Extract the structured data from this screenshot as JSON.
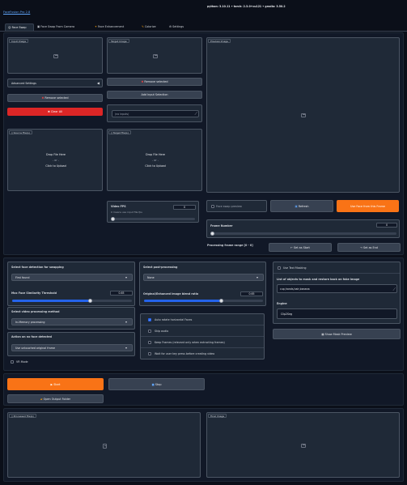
{
  "header": {
    "app_link": "FaceFusion Pro 2.8",
    "version_info": "python: 3.10.11  •  torch: 2.3.0+cu121  •  gradio: 3.50.2"
  },
  "tabs": [
    {
      "label": "Face Swap",
      "icon": "face-icon",
      "active": true
    },
    {
      "label": "Face Swap From Camera",
      "icon": "camera-icon",
      "active": false
    },
    {
      "label": "Face Enhancement",
      "icon": "sparkle-icon",
      "active": false
    },
    {
      "label": "Colorize",
      "icon": "brush-icon",
      "active": false
    },
    {
      "label": "Settings",
      "icon": "gear-icon",
      "active": false
    }
  ],
  "left": {
    "input_image_label": "Input Image",
    "advanced_settings_label": "Advanced Settings",
    "remove_selected_label": "Remove selected",
    "clear_all_label": "Clear All",
    "source_file_label": "Source File(s)",
    "drop_here": "Drop File Here",
    "or": "- or -",
    "click_upload": "Click to Upload"
  },
  "middle": {
    "face_image_label": "Target Image",
    "remove_selected_label": "Remove selected",
    "add_label": "Add Input Selection",
    "textbox_placeholder": "(no inputs)",
    "target_file_label": "Target File(s)",
    "drop_here": "Drop File Here",
    "or": "- or -",
    "click_upload": "Click to Upload",
    "fps_label": "Video FPS",
    "fps_hint": "0 means use input file fps",
    "fps_value": "0",
    "fps_level": 0.0
  },
  "right": {
    "preview_label": "Preview Image",
    "face_preview_label": "Face swap preview",
    "refresh_label": "Refresh",
    "use_face_label": "Use Face from this Frame",
    "frame_number_label": "Frame Number",
    "frame_number_value": "0",
    "frame_level": 0.0,
    "processing_range_label": "Processing frame range [0 - 0]",
    "set_start_label": "← Set as Start",
    "set_end_label": "→ Set as End"
  },
  "settings": {
    "face_detection_label": "Select face detection for swapping",
    "face_detection_value": "First found",
    "similarity_label": "Max Face Similarity Threshold",
    "similarity_value": "0.65",
    "similarity_level": 0.65,
    "video_processing_label": "Select video processing method",
    "video_processing_value": "In-Memory processing",
    "no_face_label": "Action on no face detected",
    "no_face_value": "Use untouched original frame",
    "vr_mode_label": "VR Mode",
    "post_processing_label": "Select post-processing",
    "post_processing_value": "None",
    "blend_label": "Original/Enhanced image blend ratio",
    "blend_value": "0.65",
    "blend_level": 0.65,
    "auto_rotate_label": "Auto rotate horizontal Faces",
    "skip_audio_label": "Skip audio",
    "keep_frames_label": "Keep Frames (relevant only when extracting frames)",
    "wait_user_label": "Wait for user key press before creating video",
    "text_masking_label": "Use Text Masking",
    "text_masking_list_label": "List of objects to mask and restore back on fake image",
    "text_masking_value": "cup,hands,hair,banana",
    "engine_label": "Engine",
    "engine_value": "Clip2Seg",
    "show_mask_label": "Show Mask Preview"
  },
  "actions": {
    "start_label": "Start",
    "stop_label": "Stop",
    "open_folder_label": "Open Output Folder"
  },
  "output": {
    "processed_label": "Processed File(s)",
    "final_image_label": "Final Image"
  },
  "colors": {
    "accent_orange": "#f97316",
    "danger_red": "#dc2626",
    "primary_blue": "#2563eb"
  }
}
